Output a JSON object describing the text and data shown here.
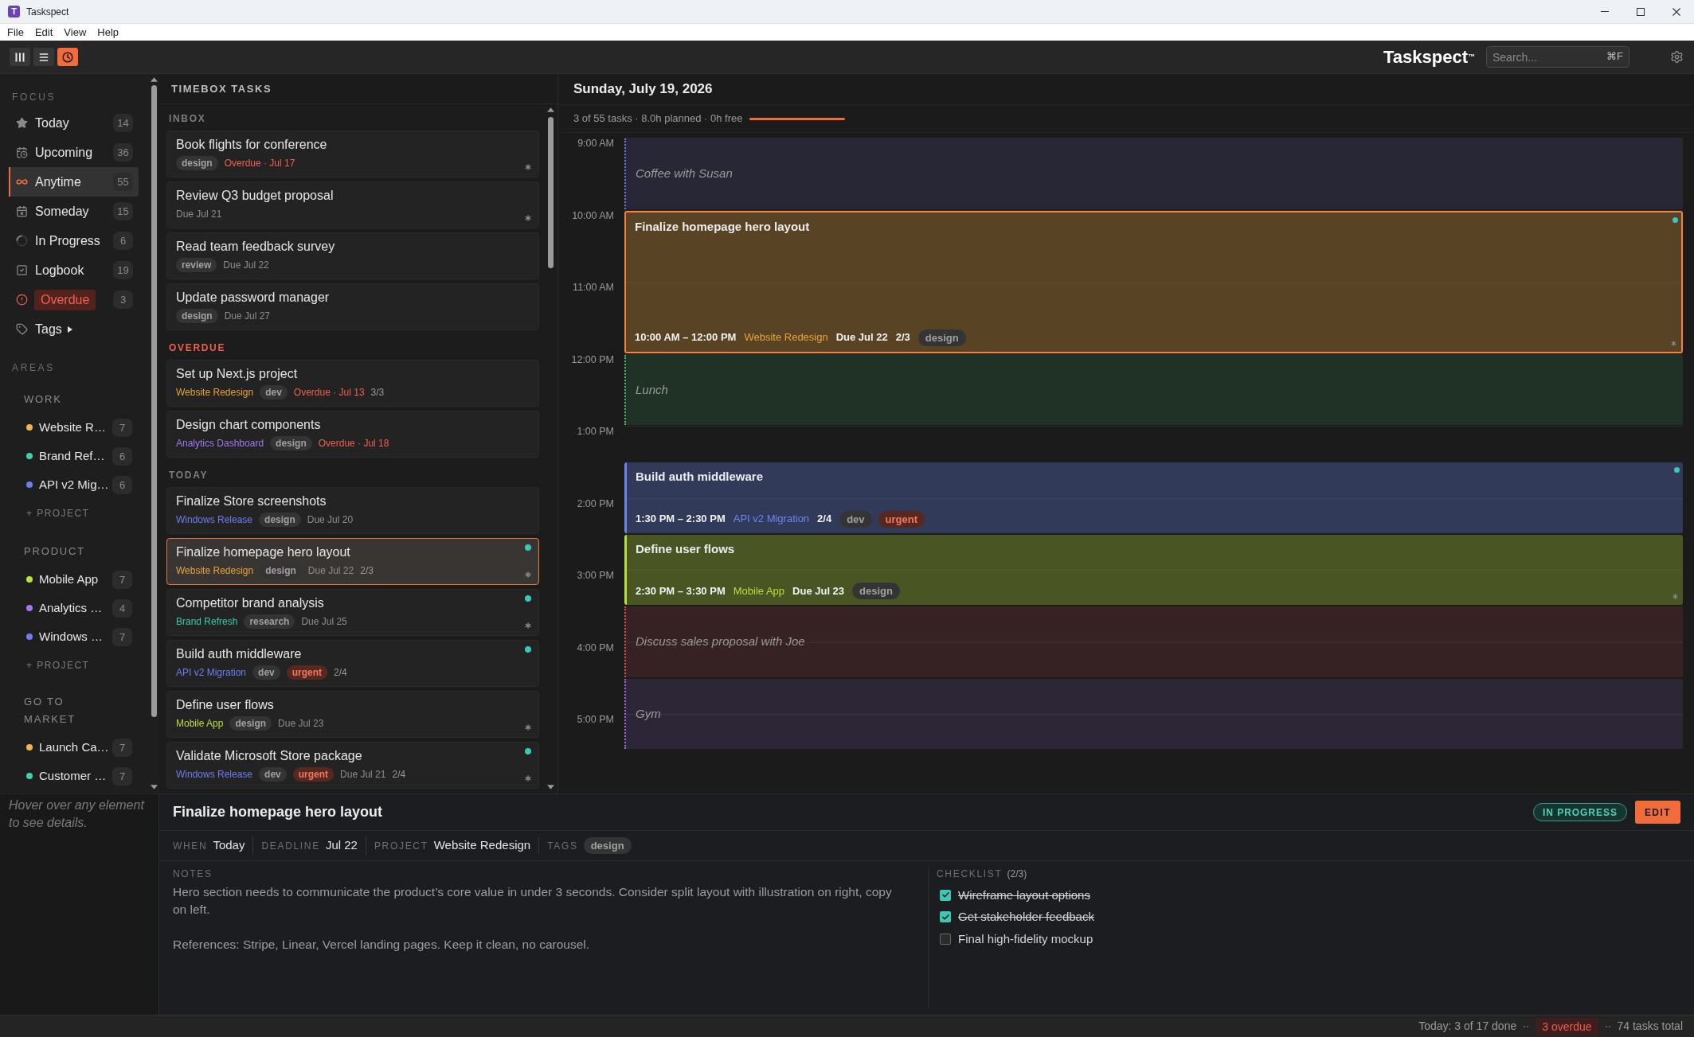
{
  "window": {
    "icon_letter": "T",
    "title": "Taskspect"
  },
  "menu": [
    "File",
    "Edit",
    "View",
    "Help"
  ],
  "toolbar": {
    "views": [
      {
        "kind": "board",
        "selected": false
      },
      {
        "kind": "list",
        "selected": false
      },
      {
        "kind": "timebox",
        "selected": true
      }
    ],
    "logo": "Taskspect$^{™}$",
    "search": {
      "placeholder": "Search...",
      "shortcut": "⌘F"
    }
  },
  "sidebar": {
    "focus_label": "FOCUS",
    "focus_items": [
      {
        "kind": "today",
        "label": "Today",
        "count": "14",
        "selected": false
      },
      {
        "kind": "upcoming",
        "label": "Upcoming",
        "count": "36",
        "selected": false
      },
      {
        "kind": "anytime",
        "label": "Anytime",
        "count": "55",
        "selected": true
      },
      {
        "kind": "someday",
        "label": "Someday",
        "count": "15",
        "selected": false
      },
      {
        "kind": "in_progress",
        "label": "In Progress",
        "count": "6",
        "selected": false
      },
      {
        "kind": "logbook",
        "label": "Logbook",
        "count": "19",
        "selected": false
      },
      {
        "kind": "overdue",
        "label": "Overdue",
        "count": "3",
        "selected": false
      },
      {
        "kind": "tags",
        "label": "Tags",
        "expanded": false,
        "selected": false
      }
    ],
    "areas_label": "AREAS",
    "groups": [
      {
        "name": "WORK",
        "projects": [
          {
            "name": "Website R…",
            "color": "#f5b540",
            "count": "7"
          },
          {
            "name": "Brand Ref…",
            "color": "#3dd1b0",
            "count": "6"
          },
          {
            "name": "API v2 Mig…",
            "color": "#6b7ff0",
            "count": "6"
          }
        ],
        "add_label": "+ PROJECT"
      },
      {
        "name": "PRODUCT",
        "projects": [
          {
            "name": "Mobile App",
            "color": "#b8e040",
            "count": "7"
          },
          {
            "name": "Analytics …",
            "color": "#a675f0",
            "count": "4"
          },
          {
            "name": "Windows …",
            "color": "#6b7ff0",
            "count": "7"
          }
        ],
        "add_label": "+ PROJECT"
      },
      {
        "name": "GO TO MARKET",
        "projects": [
          {
            "name": "Launch Ca…",
            "color": "#f5b540",
            "count": "7"
          },
          {
            "name": "Customer …",
            "color": "#3dd1b0",
            "count": "7"
          }
        ]
      }
    ],
    "hint": "Hover over any element to see details."
  },
  "task_list": {
    "title": "TIMEBOX TASKS",
    "sections": [
      {
        "kind": "inbox",
        "title": "INBOX",
        "tasks": [
          {
            "title": "Book flights for conference",
            "tags": [
              {
                "label": "design",
                "kind": "plain"
              }
            ],
            "due": {
              "text": "Overdue · Jul 17",
              "overdue": true
            },
            "in_progress": false,
            "asterisk_mark": true,
            "selected": false
          },
          {
            "title": "Review Q3 budget proposal",
            "due": {
              "text": "Due Jul 21",
              "overdue": false
            },
            "in_progress": false,
            "asterisk_mark": true,
            "selected": false
          },
          {
            "title": "Read team feedback survey",
            "tags": [
              {
                "label": "review",
                "kind": "plain"
              }
            ],
            "due": {
              "text": "Due Jul 22",
              "overdue": false
            },
            "in_progress": false,
            "asterisk_mark": false,
            "selected": false
          },
          {
            "title": "Update password manager",
            "tags": [
              {
                "label": "design",
                "kind": "plain"
              }
            ],
            "due": {
              "text": "Due Jul 27",
              "overdue": false
            },
            "in_progress": false,
            "asterisk_mark": false,
            "selected": false
          }
        ]
      },
      {
        "kind": "overdue",
        "title": "OVERDUE",
        "tasks": [
          {
            "title": "Set up Next.js project",
            "project": {
              "name": "Website Redesign",
              "color": "#e8a33c"
            },
            "tags": [
              {
                "label": "dev",
                "kind": "plain"
              }
            ],
            "due": {
              "text": "Overdue · Jul 13",
              "overdue": true
            },
            "checklist": "3/3",
            "in_progress": false,
            "asterisk_mark": false,
            "selected": false
          },
          {
            "title": "Design chart components",
            "project": {
              "name": "Analytics Dashboard",
              "color": "#a675f0"
            },
            "tags": [
              {
                "label": "design",
                "kind": "plain"
              }
            ],
            "due": {
              "text": "Overdue · Jul 18",
              "overdue": true
            },
            "in_progress": false,
            "asterisk_mark": false,
            "selected": false
          }
        ]
      },
      {
        "kind": "today",
        "title": "TODAY",
        "tasks": [
          {
            "title": "Finalize Store screenshots",
            "project": {
              "name": "Windows Release",
              "color": "#6b7ff0"
            },
            "tags": [
              {
                "label": "design",
                "kind": "plain"
              }
            ],
            "due": {
              "text": "Due Jul 20",
              "overdue": false
            },
            "in_progress": false,
            "asterisk_mark": false,
            "selected": false
          },
          {
            "title": "Finalize homepage hero layout",
            "project": {
              "name": "Website Redesign",
              "color": "#e8a33c"
            },
            "tags": [
              {
                "label": "design",
                "kind": "plain"
              }
            ],
            "due": {
              "text": "Due Jul 22",
              "overdue": false
            },
            "checklist": "2/3",
            "in_progress": true,
            "asterisk_mark": true,
            "selected": true
          },
          {
            "title": "Competitor brand analysis",
            "project": {
              "name": "Brand Refresh",
              "color": "#3cc8a8"
            },
            "tags": [
              {
                "label": "research",
                "kind": "plain"
              }
            ],
            "due": {
              "text": "Due Jul 25",
              "overdue": false
            },
            "in_progress": true,
            "asterisk_mark": true,
            "selected": false
          },
          {
            "title": "Build auth middleware",
            "project": {
              "name": "API v2 Migration",
              "color": "#6b7ff0"
            },
            "tags": [
              {
                "label": "dev",
                "kind": "plain"
              },
              {
                "label": "urgent",
                "kind": "urgent"
              }
            ],
            "checklist": "2/4",
            "in_progress": true,
            "asterisk_mark": false,
            "selected": false
          },
          {
            "title": "Define user flows",
            "project": {
              "name": "Mobile App",
              "color": "#b5e03a"
            },
            "tags": [
              {
                "label": "design",
                "kind": "plain"
              }
            ],
            "due": {
              "text": "Due Jul 23",
              "overdue": false
            },
            "in_progress": false,
            "asterisk_mark": true,
            "selected": false
          },
          {
            "title": "Validate Microsoft Store package",
            "project": {
              "name": "Windows Release",
              "color": "#6b7ff0"
            },
            "tags": [
              {
                "label": "dev",
                "kind": "plain"
              },
              {
                "label": "urgent",
                "kind": "urgent"
              }
            ],
            "due": {
              "text": "Due Jul 21",
              "overdue": false
            },
            "checklist": "2/4",
            "in_progress": true,
            "asterisk_mark": true,
            "selected": false
          }
        ]
      }
    ]
  },
  "calendar": {
    "date": "Sunday, July 19, 2026",
    "summary": "3 of 55 tasks · 8.0h planned · 0h free",
    "plan": {
      "level": 1
    },
    "hours": [
      "9:00 AM",
      "10:00 AM",
      "11:00 AM",
      "12:00 PM",
      "1:00 PM",
      "2:00 PM",
      "3:00 PM",
      "4:00 PM",
      "5:00 PM"
    ],
    "blocks": [
      {
        "kind": "event",
        "title": "Coffee with Susan",
        "color": "#6f74d8"
      },
      {
        "kind": "task",
        "title": "Finalize homepage hero layout",
        "time": "10:00 AM – 12:00 PM",
        "project": {
          "name": "Website Redesign",
          "color": "#e8a33c"
        },
        "due": "Due Jul 22",
        "checklist": "2/3",
        "tags": [
          {
            "label": "design",
            "kind": "plain"
          }
        ],
        "in_progress": true,
        "asterisk_mark": true,
        "selected": true
      },
      {
        "kind": "event",
        "title": "Lunch",
        "color": "#46b86a"
      },
      {
        "kind": "task",
        "title": "Build auth middleware",
        "time": "1:30 PM – 2:30 PM",
        "project": {
          "name": "API v2 Migration",
          "color": "#6b85f0"
        },
        "checklist": "2/4",
        "tags": [
          {
            "label": "dev",
            "kind": "plain"
          },
          {
            "label": "urgent",
            "kind": "urgent"
          }
        ],
        "in_progress": true,
        "asterisk_mark": false,
        "selected": false
      },
      {
        "kind": "task",
        "title": "Define user flows",
        "time": "2:30 PM – 3:30 PM",
        "project": {
          "name": "Mobile App",
          "color": "#b5e03a"
        },
        "due": "Due Jul 23",
        "tags": [
          {
            "label": "design",
            "kind": "plain"
          }
        ],
        "in_progress": false,
        "asterisk_mark": true,
        "selected": false
      },
      {
        "kind": "event",
        "title": "Discuss sales proposal with Joe",
        "color": "#d9534f"
      },
      {
        "kind": "event",
        "title": "Gym",
        "color": "#9a6ae0"
      }
    ]
  },
  "detail": {
    "title": "Finalize homepage hero layout",
    "status": {
      "label": "IN PROGRESS",
      "kind": "in_progress"
    },
    "edit_label": "EDIT",
    "fields": [
      {
        "kind": "text",
        "label": "WHEN",
        "value": "Today"
      },
      {
        "kind": "text",
        "label": "DEADLINE",
        "value": "Jul 22"
      },
      {
        "kind": "text",
        "label": "PROJECT",
        "value": "Website Redesign"
      },
      {
        "kind": "tags",
        "label": "TAGS",
        "tags": [
          "design"
        ]
      }
    ],
    "notes_label": "NOTES",
    "notes": [
      "Hero section needs to communicate the product’s core value in under 3 seconds. Consider split layout with illustration on right, copy on left.",
      "References: Stripe, Linear, Vercel landing pages. Keep it clean, no carousel."
    ],
    "checklist": {
      "label": "CHECKLIST",
      "count": "(2/3)",
      "items": [
        {
          "text": "Wireframe layout options",
          "checked": true
        },
        {
          "text": "Get stakeholder feedback",
          "checked": true
        },
        {
          "text": "Final high-fidelity mockup",
          "checked": false
        }
      ]
    }
  },
  "status_bar": {
    "items": [
      {
        "kind": "plain",
        "text": "Today: 3 of 17 done"
      },
      {
        "kind": "alert",
        "text": "3 overdue"
      },
      {
        "kind": "plain",
        "text": "74 tasks total"
      }
    ]
  }
}
